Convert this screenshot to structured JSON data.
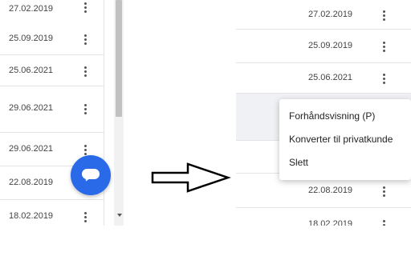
{
  "left_list": {
    "dates": [
      "27.02.2019",
      "25.09.2019",
      "25.06.2021",
      "29.06.2021",
      "29.06.2021",
      "22.08.2019",
      "18.02.2019"
    ]
  },
  "right_list": {
    "dates": [
      "27.02.2019",
      "25.09.2019",
      "25.06.2021",
      "",
      "",
      "22.08.2019",
      "18.02.2019"
    ]
  },
  "context_menu": {
    "items": [
      "Forhåndsvisning (P)",
      "Konverter til privatkunde",
      "Slett"
    ]
  },
  "chat_button": {
    "icon": "chat-bubble-icon",
    "color": "#2a6ae8"
  },
  "arrow": {
    "icon": "right-arrow-icon"
  },
  "colors": {
    "row_highlight": "#f0f1f4",
    "divider": "#e4e4e4"
  }
}
